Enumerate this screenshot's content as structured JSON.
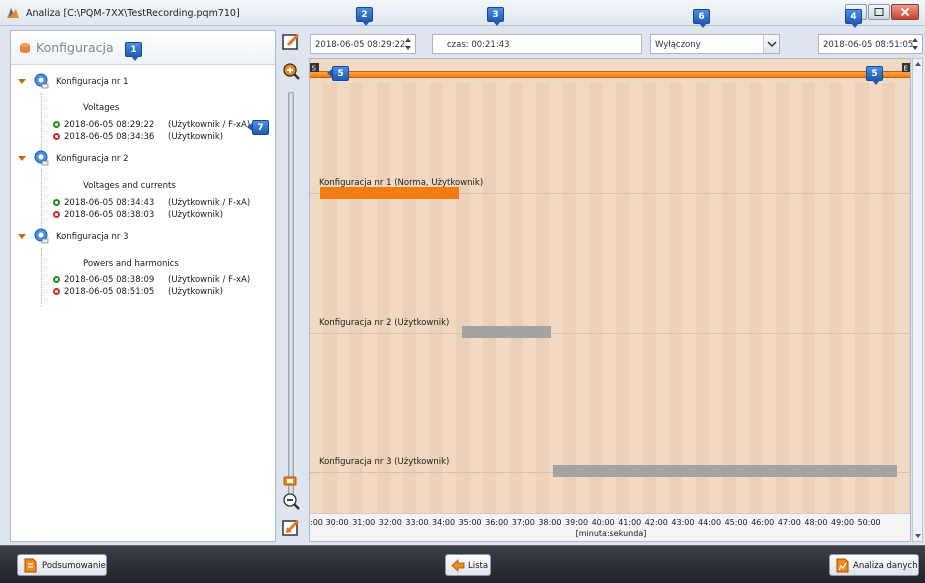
{
  "window": {
    "title": "Analiza [C:\\PQM-7XX\\TestRecording.pqm710]"
  },
  "callouts": {
    "c1": "1",
    "c2": "2",
    "c3": "3",
    "c4": "4",
    "c5a": "5",
    "c5b": "5",
    "c6": "6",
    "c7": "7"
  },
  "left_panel": {
    "title": "Konfiguracja",
    "configs": [
      {
        "label": "Konfiguracja nr 1",
        "description": "Voltages",
        "start_time": "2018-06-05 08:29:22",
        "start_user": "(Użytkownik / F-xA)",
        "stop_time": "2018-06-05 08:34:36",
        "stop_user": "(Użytkownik)"
      },
      {
        "label": "Konfiguracja nr 2",
        "description": "Voltages and currents",
        "start_time": "2018-06-05 08:34:43",
        "start_user": "(Użytkownik / F-xA)",
        "stop_time": "2018-06-05 08:38:03",
        "stop_user": "(Użytkownik)"
      },
      {
        "label": "Konfiguracja nr 3",
        "description": "Powers and harmonics",
        "start_time": "2018-06-05 08:38:09",
        "start_user": "(Użytkownik / F-xA)",
        "stop_time": "2018-06-05 08:51:05",
        "stop_user": "(Użytkownik)"
      }
    ]
  },
  "controls": {
    "start_time": "2018-06-05 08:29:22",
    "duration": "czas: 00:21:43",
    "filter_value": "Wyłączony",
    "end_time": "2018-06-05 08:51:05"
  },
  "timeline": {
    "range_start_marker": "S",
    "range_end_marker": "E",
    "rows": [
      {
        "label": "Konfiguracja nr 1 (Norma, Użytkownik)",
        "start_min": 29.37,
        "end_min": 34.6,
        "color": "#f07c12"
      },
      {
        "label": "Konfiguracja nr 2 (Użytkownik)",
        "start_min": 34.72,
        "end_min": 38.05,
        "color": "#a3a3a3"
      },
      {
        "label": "Konfiguracja nr 3 (Użytkownik)",
        "start_min": 38.15,
        "end_min": 51.08,
        "color": "#a3a3a3"
      }
    ],
    "axis": {
      "ticks": [
        ":00",
        "30:00",
        "31:00",
        "32:00",
        "33:00",
        "34:00",
        "35:00",
        "36:00",
        "37:00",
        "38:00",
        "39:00",
        "40:00",
        "41:00",
        "42:00",
        "43:00",
        "44:00",
        "45:00",
        "46:00",
        "47:00",
        "48:00",
        "49:00",
        "50:00"
      ],
      "unit": "[minuta:sekunda]"
    }
  },
  "bottom_bar": {
    "summary_label": "Podsumowanie",
    "list_label": "Lista",
    "analysis_label": "Analiza danych"
  },
  "colors": {
    "accent_orange": "#f07c12",
    "timeline_bg": "#f1d9c4",
    "inactive_bar": "#a3a3a3"
  }
}
